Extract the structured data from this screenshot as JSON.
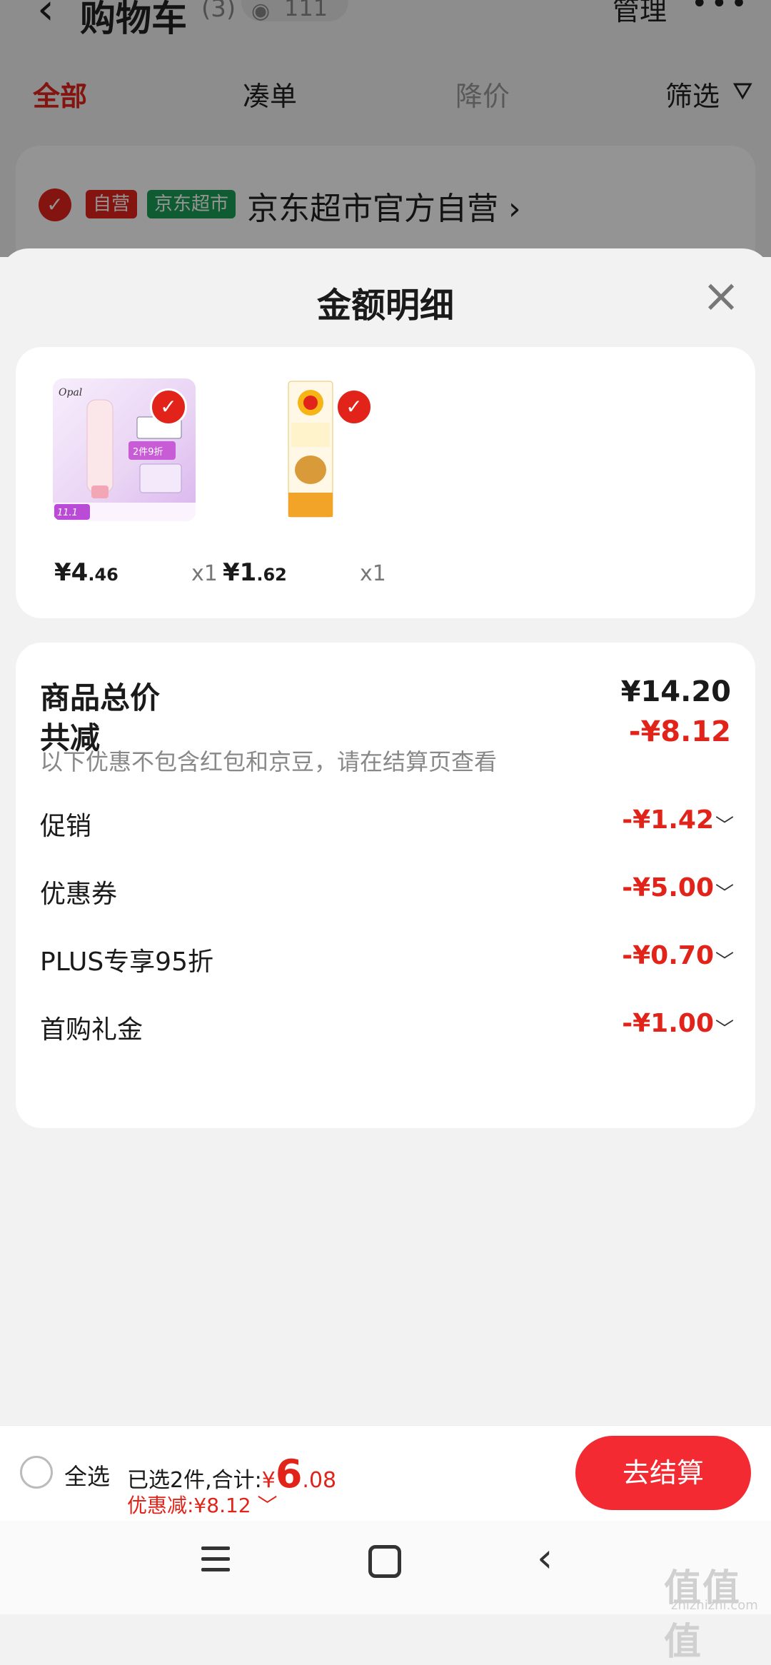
{
  "background": {
    "title": "购物车",
    "count": "(3)",
    "watch_count": "111",
    "manage": "管理",
    "tabs": [
      "全部",
      "凑单",
      "降价",
      "筛选"
    ],
    "store": {
      "badge_self": "自营",
      "badge_market": "京东超市",
      "name": "京东超市官方自营 ›"
    }
  },
  "sheet": {
    "title": "金额明细",
    "items": [
      {
        "price_int": "¥4",
        "price_dec": ".46",
        "qty": "x1"
      },
      {
        "price_int": "¥1",
        "price_dec": ".62",
        "qty": "x1"
      }
    ],
    "total_label": "商品总价",
    "total_value": "¥14.20",
    "reduce_label": "共减",
    "reduce_value": "-¥8.12",
    "note": "以下优惠不包含红包和京豆，请在结算页查看",
    "discounts": [
      {
        "label": "促销",
        "value": "-¥1.42"
      },
      {
        "label": "优惠券",
        "value": "-¥5.00"
      },
      {
        "label": "PLUS专享95折",
        "value": "-¥0.70"
      },
      {
        "label": "首购礼金",
        "value": "-¥1.00"
      }
    ]
  },
  "bottom": {
    "select_all": "全选",
    "summary_prefix": "已选2件,合计:",
    "total_yen": "¥",
    "total_int": "6",
    "total_dec": ".08",
    "discount_line": "优惠减:¥8.12 ﹀",
    "checkout": "去结算"
  },
  "watermark": {
    "main": "值值值",
    "sub": "zhizhizhi.com"
  },
  "colors": {
    "accent": "#e2231a",
    "checkout": "#f42a32",
    "market_green": "#1b9f56"
  }
}
